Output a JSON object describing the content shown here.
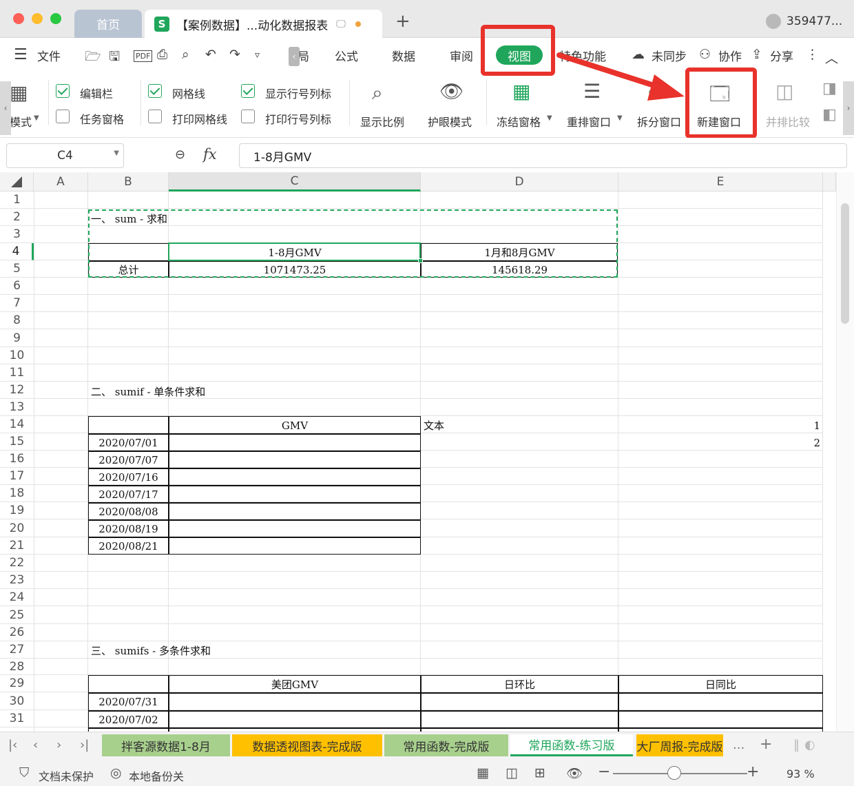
{
  "titlebar": {
    "home_tab": "首页",
    "doc_tab": "【案例数据】...动化数据报表",
    "sheet_logo": "S",
    "user": "359477..."
  },
  "menu": {
    "file": "文件",
    "items": [
      "局",
      "公式",
      "数据",
      "审阅",
      "视图",
      "特色功能"
    ],
    "sync": "未同步",
    "collab": "协作",
    "share": "分享"
  },
  "ribbon": {
    "mode_partial": "模式",
    "checkboxes": [
      {
        "label": "编辑栏",
        "checked": true
      },
      {
        "label": "任务窗格",
        "checked": false
      },
      {
        "label": "网格线",
        "checked": true
      },
      {
        "label": "打印网格线",
        "checked": false
      },
      {
        "label": "显示行号列标",
        "checked": true
      },
      {
        "label": "打印行号列标",
        "checked": false
      }
    ],
    "buttons": [
      "显示比例",
      "护眼模式",
      "冻结窗格",
      "重排窗口",
      "拆分窗口",
      "新建窗口",
      "并排比较"
    ]
  },
  "formula": {
    "cell_ref": "C4",
    "fx": "fx",
    "value": "1-8月GMV"
  },
  "columns": [
    "A",
    "B",
    "C",
    "D",
    "E"
  ],
  "rows": [
    "1",
    "2",
    "3",
    "4",
    "5",
    "6",
    "7",
    "8",
    "9",
    "10",
    "11",
    "12",
    "13",
    "14",
    "15",
    "16",
    "17",
    "18",
    "19",
    "20",
    "21",
    "22",
    "23",
    "24",
    "25",
    "26",
    "27",
    "28",
    "29",
    "30",
    "31"
  ],
  "cells": {
    "s1_title": "一、 sum - 求和",
    "c4": "1-8月GMV",
    "d4": "1月和8月GMV",
    "b5": "总计",
    "c5": "1071473.25",
    "d5": "145618.29",
    "s2_title": "二、 sumif - 单条件求和",
    "c14": "GMV",
    "d14": "文本",
    "e14": "1",
    "e15": "2",
    "dates": [
      "2020/07/01",
      "2020/07/07",
      "2020/07/16",
      "2020/07/17",
      "2020/08/08",
      "2020/08/19",
      "2020/08/21"
    ],
    "s3_title": "三、 sumifs - 多条件求和",
    "c29": "美团GMV",
    "d29": "日环比",
    "e29": "日同比",
    "b30": "2020/07/31",
    "b31": "2020/07/02"
  },
  "sheets": [
    {
      "name": "拌客源数据1-8月",
      "color": "#a8d08d"
    },
    {
      "name": "数据透视图表-完成版",
      "color": "#ffc000"
    },
    {
      "name": "常用函数-完成版",
      "color": "#a8d08d"
    },
    {
      "name": "常用函数-练习版",
      "color": "#ffffff"
    },
    {
      "name": "大厂周报-完成版",
      "color": "#ffc000"
    }
  ],
  "sheet_more": "...",
  "status": {
    "protect": "文档未保护",
    "backup": "本地备份关",
    "zoom": "93 %"
  },
  "colors": {
    "accent": "#1fa65b",
    "highlight": "#e8322b"
  }
}
